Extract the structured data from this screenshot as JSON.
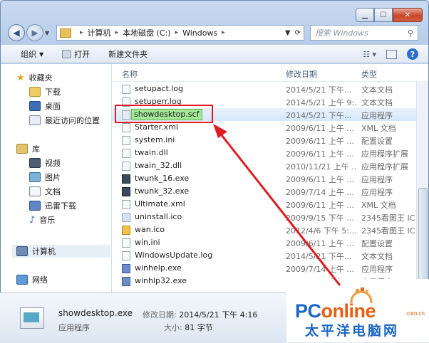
{
  "address": {
    "crumbs": [
      "计算机",
      "本地磁盘 (C:)",
      "Windows"
    ],
    "search_placeholder": "搜索 Windows"
  },
  "toolbar": {
    "organize": "组织",
    "open": "打开",
    "new_folder": "新建文件夹"
  },
  "nav": {
    "favorites": "收藏夹",
    "downloads": "下载",
    "desktop": "桌面",
    "recent": "最近访问的位置",
    "libraries": "库",
    "videos": "视频",
    "pictures": "图片",
    "documents": "文档",
    "xunlei": "迅雷下载",
    "music": "音乐",
    "computer": "计算机",
    "network": "网络"
  },
  "columns": {
    "name": "名称",
    "date": "修改日期",
    "type": "类型"
  },
  "files": [
    {
      "name": "setupact.log",
      "date": "2014/5/21 下午...",
      "type": "文本文档"
    },
    {
      "name": "setuperr.log",
      "date": "2014/5/21 上午 9:...",
      "type": "文本文档"
    },
    {
      "name": "showdesktop.scf",
      "date": "2014/5/21 下午...",
      "type": "应用程序"
    },
    {
      "name": "Starter.xml",
      "date": "2009/6/11 上午 ...",
      "type": "XML 文档"
    },
    {
      "name": "system.ini",
      "date": "2009/6/11 上午 ...",
      "type": "配置设置"
    },
    {
      "name": "twain.dll",
      "date": "2009/6/11 上午 ...",
      "type": "应用程序扩展"
    },
    {
      "name": "twain_32.dll",
      "date": "2010/11/21 上午 ...",
      "type": "应用程序扩展"
    },
    {
      "name": "twunk_16.exe",
      "date": "2009/6/11 上午 ...",
      "type": "应用程序"
    },
    {
      "name": "twunk_32.exe",
      "date": "2009/7/14 上午 ...",
      "type": "应用程序"
    },
    {
      "name": "Ultimate.xml",
      "date": "2009/6/11 上午 ...",
      "type": "XML 文档"
    },
    {
      "name": "uninstall.ico",
      "date": "2009/9/15 下午 ...",
      "type": "2345看图王 IC"
    },
    {
      "name": "wan.ico",
      "date": "2012/4/6 下午 5:...",
      "type": "2345看图王 IC"
    },
    {
      "name": "win.ini",
      "date": "2009/6/11 上午 ...",
      "type": "配置设置"
    },
    {
      "name": "WindowsUpdate.log",
      "date": "2014/5/21 下午...",
      "type": "文本文档"
    },
    {
      "name": "winhelp.exe",
      "date": "2009/7/14 上午 ...",
      "type": "应用程序"
    },
    {
      "name": "winhlp32.exe",
      "date": "2009/7/14 上午 ...",
      "type": "应用程序"
    }
  ],
  "status": {
    "file_name": "showdesktop.exe",
    "date_label": "修改日期:",
    "date_value": "2014/5/21 下午 4:16",
    "file_type": "应用程序",
    "size_label": "大小:",
    "size_value": "81 字节"
  },
  "watermark": {
    "brand_pc": "PC",
    "brand_online": "online",
    "domain_suffix": ".com.cn",
    "cn_name": "太平洋电脑网"
  },
  "colors": {
    "highlight_box": "#e01b22",
    "rename_field": "#a3e896",
    "arrow": "#e01b22"
  }
}
